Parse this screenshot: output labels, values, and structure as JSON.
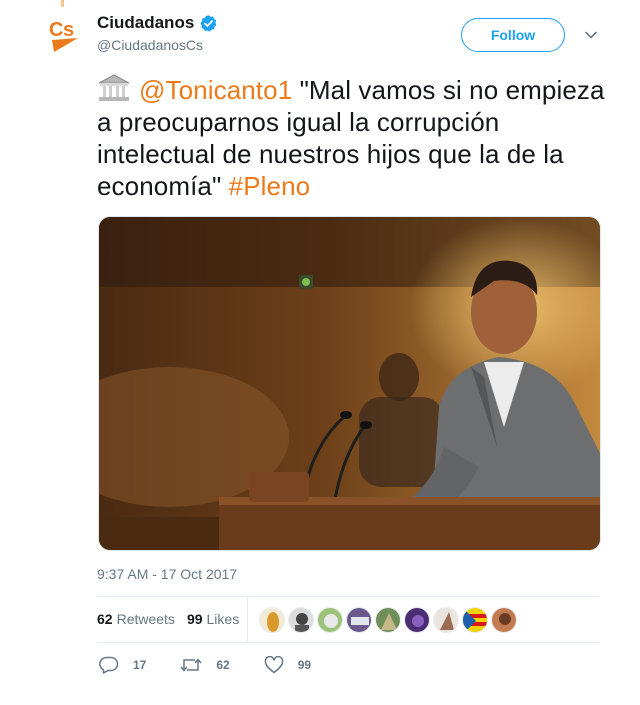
{
  "user": {
    "display_name": "Ciudadanos",
    "handle": "@CiudadanosCs",
    "verified": true,
    "brand_color": "#ed7a1a",
    "avatar_text": "Cs"
  },
  "follow_button": {
    "label": "Follow"
  },
  "tweet": {
    "emoji": "classical-building-emoji",
    "mention": "@Tonicanto1",
    "body": " \"Mal vamos si no empieza a preocuparnos igual la corrupción intelectual de nuestros hijos que la de la economía\" ",
    "hashtag": "#Pleno",
    "image_description_icon": "photo-parliament-speaker"
  },
  "timestamp": "9:37 AM - 17 Oct 2017",
  "stats": {
    "retweets_count": "62",
    "retweets_label": "Retweets",
    "likes_count": "99",
    "likes_label": "Likes"
  },
  "actions": {
    "reply_count": "17",
    "retweet_count": "62",
    "like_count": "99"
  },
  "colors": {
    "link": "#ed7a1a",
    "follow": "#1da1f2",
    "verified": "#1da1f2",
    "muted": "#657786"
  }
}
